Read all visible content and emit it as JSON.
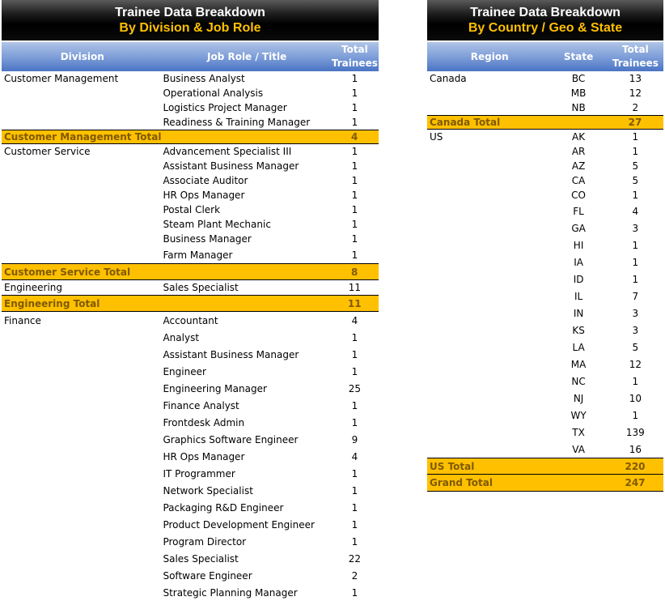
{
  "division_table": {
    "title": "Trainee Data Breakdown",
    "subtitle": "By Division & Job Role",
    "headers": [
      "Division",
      "Job Role / Title",
      "Total Trainees"
    ],
    "headers_split": {
      "total_line1": "Total",
      "total_line2": "Trainees"
    },
    "groups": [
      {
        "division": "Customer Management",
        "rows": [
          {
            "role": "Business Analyst",
            "count": "1"
          },
          {
            "role": "Operational Analysis",
            "count": "1"
          },
          {
            "role": "Logistics Project Manager",
            "count": "1"
          },
          {
            "role": "Readiness & Training Manager",
            "count": "1"
          }
        ],
        "total_label": "Customer Management Total",
        "total": "4"
      },
      {
        "division": "Customer Service",
        "rows": [
          {
            "role": "Advancement Specialist III",
            "count": "1"
          },
          {
            "role": "Assistant Business Manager",
            "count": "1"
          },
          {
            "role": "Associate Auditor",
            "count": "1"
          },
          {
            "role": "HR Ops Manager",
            "count": "1"
          },
          {
            "role": "Postal Clerk",
            "count": "1"
          },
          {
            "role": "Steam Plant Mechanic",
            "count": "1"
          },
          {
            "role": "Business Manager",
            "count": "1"
          },
          {
            "role": "Farm Manager",
            "count": "1"
          }
        ],
        "total_label": "Customer Service Total",
        "total": "8"
      },
      {
        "division": "Engineering",
        "rows": [
          {
            "role": "Sales Specialist",
            "count": "11"
          }
        ],
        "total_label": "Engineering Total",
        "total": "11"
      },
      {
        "division": "Finance",
        "rows": [
          {
            "role": "Accountant",
            "count": "4"
          },
          {
            "role": "Analyst",
            "count": "1"
          },
          {
            "role": "Assistant Business Manager",
            "count": "1"
          },
          {
            "role": "Engineer",
            "count": "1"
          },
          {
            "role": "Engineering Manager",
            "count": "25"
          },
          {
            "role": "Finance Analyst",
            "count": "1"
          },
          {
            "role": "Frontdesk Admin",
            "count": "1"
          },
          {
            "role": "Graphics Software Engineer",
            "count": "9"
          },
          {
            "role": "HR Ops Manager",
            "count": "4"
          },
          {
            "role": "IT Programmer",
            "count": "1"
          },
          {
            "role": "Network Specialist",
            "count": "1"
          },
          {
            "role": "Packaging R&D Engineer",
            "count": "1"
          },
          {
            "role": "Product Development Engineer",
            "count": "1"
          },
          {
            "role": "Program Director",
            "count": "1"
          },
          {
            "role": "Sales Specialist",
            "count": "22"
          },
          {
            "role": "Software Engineer",
            "count": "2"
          },
          {
            "role": "Strategic Planning Manager",
            "count": "1"
          }
        ]
      }
    ]
  },
  "geo_table": {
    "title": "Trainee Data Breakdown",
    "subtitle": "By Country / Geo & State",
    "headers": [
      "Region",
      "State",
      "Total Trainees"
    ],
    "headers_split": {
      "total_line1": "Total",
      "total_line2": "Trainees"
    },
    "groups": [
      {
        "region": "Canada",
        "rows": [
          {
            "state": "BC",
            "count": "13"
          },
          {
            "state": "MB",
            "count": "12"
          },
          {
            "state": "NB",
            "count": "2"
          }
        ],
        "total_label": "Canada Total",
        "total": "27"
      },
      {
        "region": "US",
        "rows": [
          {
            "state": "AK",
            "count": "1"
          },
          {
            "state": "AR",
            "count": "1"
          },
          {
            "state": "AZ",
            "count": "5"
          },
          {
            "state": "CA",
            "count": "5"
          },
          {
            "state": "CO",
            "count": "1"
          },
          {
            "state": "FL",
            "count": "4"
          },
          {
            "state": "GA",
            "count": "3"
          },
          {
            "state": "HI",
            "count": "1"
          },
          {
            "state": "IA",
            "count": "1"
          },
          {
            "state": "ID",
            "count": "1"
          },
          {
            "state": "IL",
            "count": "7"
          },
          {
            "state": "IN",
            "count": "3"
          },
          {
            "state": "KS",
            "count": "3"
          },
          {
            "state": "LA",
            "count": "5"
          },
          {
            "state": "MA",
            "count": "12"
          },
          {
            "state": "NC",
            "count": "1"
          },
          {
            "state": "NJ",
            "count": "10"
          },
          {
            "state": "WY",
            "count": "1"
          },
          {
            "state": "TX",
            "count": "139"
          },
          {
            "state": "VA",
            "count": "16"
          }
        ],
        "total_label": "US Total",
        "total": "220"
      }
    ],
    "grand_total_label": "Grand Total",
    "grand_total": "247"
  },
  "colors": {
    "total_fill": "#ffc000",
    "header_blue": "#4f81bd",
    "title_gold": "#ffc000"
  }
}
